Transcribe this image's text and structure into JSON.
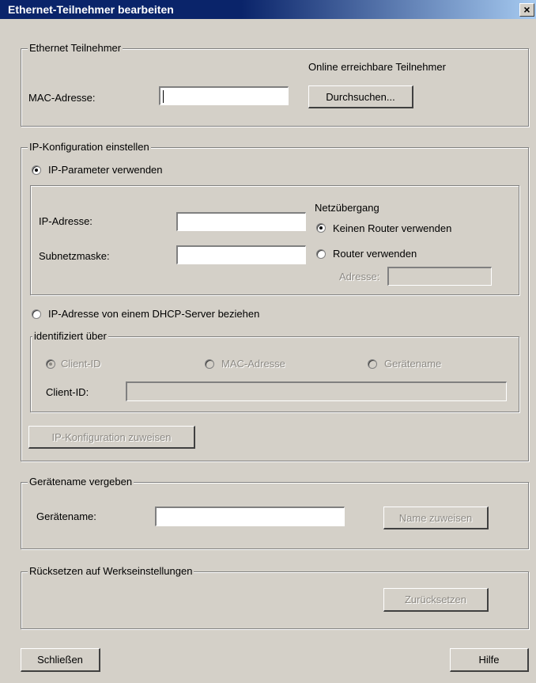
{
  "window": {
    "title": "Ethernet-Teilnehmer bearbeiten",
    "close_glyph": "×"
  },
  "ethernet": {
    "legend": "Ethernet Teilnehmer",
    "online_label": "Online erreichbare Teilnehmer",
    "mac_label": "MAC-Adresse:",
    "mac_value": "",
    "browse_button": "Durchsuchen..."
  },
  "ipconfig": {
    "legend": "IP-Konfiguration einstellen",
    "use_params_label": "IP-Parameter verwenden",
    "ip_label": "IP-Adresse:",
    "ip_value": "",
    "subnet_label": "Subnetzmaske:",
    "subnet_value": "",
    "gateway_heading": "Netzübergang",
    "no_router_label": "Keinen Router verwenden",
    "router_label": "Router verwenden",
    "address_label": "Adresse:",
    "address_value": "",
    "dhcp_label": "IP-Adresse von einem DHCP-Server beziehen",
    "identified_legend": "identifiziert über",
    "client_id_option": "Client-ID",
    "mac_option": "MAC-Adresse",
    "device_name_option": "Gerätename",
    "client_id_label": "Client-ID:",
    "client_id_value": "",
    "assign_button": "IP-Konfiguration zuweisen"
  },
  "device_name": {
    "legend": "Gerätename vergeben",
    "label": "Gerätename:",
    "value": "",
    "assign_button": "Name zuweisen"
  },
  "reset": {
    "legend": "Rücksetzen auf Werkseinstellungen",
    "button": "Zurücksetzen"
  },
  "footer": {
    "close_button": "Schließen",
    "help_button": "Hilfe"
  }
}
